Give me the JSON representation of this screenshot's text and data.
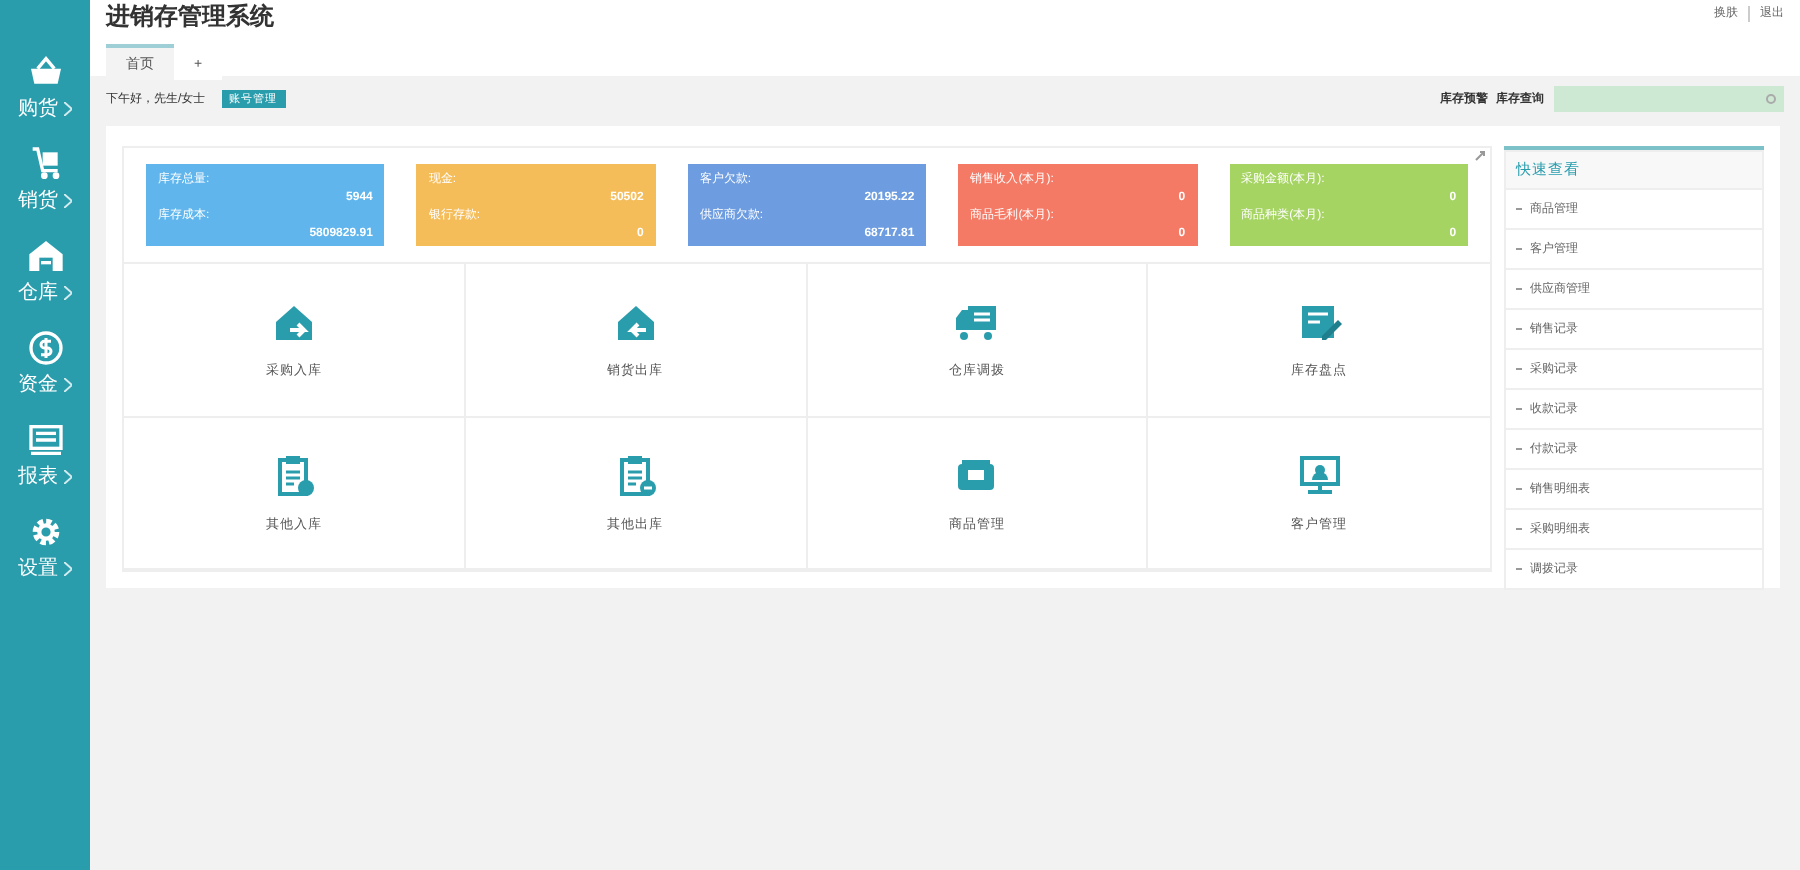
{
  "sidebar": {
    "items": [
      {
        "label": "购货"
      },
      {
        "label": "销货"
      },
      {
        "label": "仓库"
      },
      {
        "label": "资金"
      },
      {
        "label": "报表"
      },
      {
        "label": "设置"
      }
    ]
  },
  "header": {
    "title": "进销存管理系统",
    "links": [
      "换肤",
      "退出"
    ],
    "tabs": [
      {
        "label": "首页",
        "selected": true
      },
      {
        "label": "+",
        "selected": false
      }
    ]
  },
  "greeting": {
    "text": "下午好，先生/女士",
    "button": "账号管理"
  },
  "stock_links": [
    "库存预警",
    "库存查询"
  ],
  "stat_cards": [
    {
      "color": "#5fb5ec",
      "rows": [
        {
          "label": "库存总量:",
          "value": "5944"
        },
        {
          "label": "库存成本:",
          "value": "5809829.91"
        }
      ]
    },
    {
      "color": "#f5bd5a",
      "rows": [
        {
          "label": "现金:",
          "value": "50502"
        },
        {
          "label": "银行存款:",
          "value": "0"
        }
      ]
    },
    {
      "color": "#6d9de0",
      "rows": [
        {
          "label": "客户欠款:",
          "value": "20195.22"
        },
        {
          "label": "供应商欠款:",
          "value": "68717.81"
        }
      ]
    },
    {
      "color": "#f47a66",
      "rows": [
        {
          "label": "销售收入(本月):",
          "value": "0"
        },
        {
          "label": "商品毛利(本月):",
          "value": "0"
        }
      ]
    },
    {
      "color": "#a6d463",
      "rows": [
        {
          "label": "采购金额(本月):",
          "value": "0"
        },
        {
          "label": "商品种类(本月):",
          "value": "0"
        }
      ]
    }
  ],
  "shortcuts": [
    {
      "label": "采购入库"
    },
    {
      "label": "销货出库"
    },
    {
      "label": "仓库调拨"
    },
    {
      "label": "库存盘点"
    },
    {
      "label": "其他入库"
    },
    {
      "label": "其他出库"
    },
    {
      "label": "商品管理"
    },
    {
      "label": "客户管理"
    }
  ],
  "quick_view": {
    "title": "快速查看",
    "items": [
      "商品管理",
      "客户管理",
      "供应商管理",
      "销售记录",
      "采购记录",
      "收款记录",
      "付款记录",
      "销售明细表",
      "采购明细表",
      "调拨记录"
    ]
  }
}
